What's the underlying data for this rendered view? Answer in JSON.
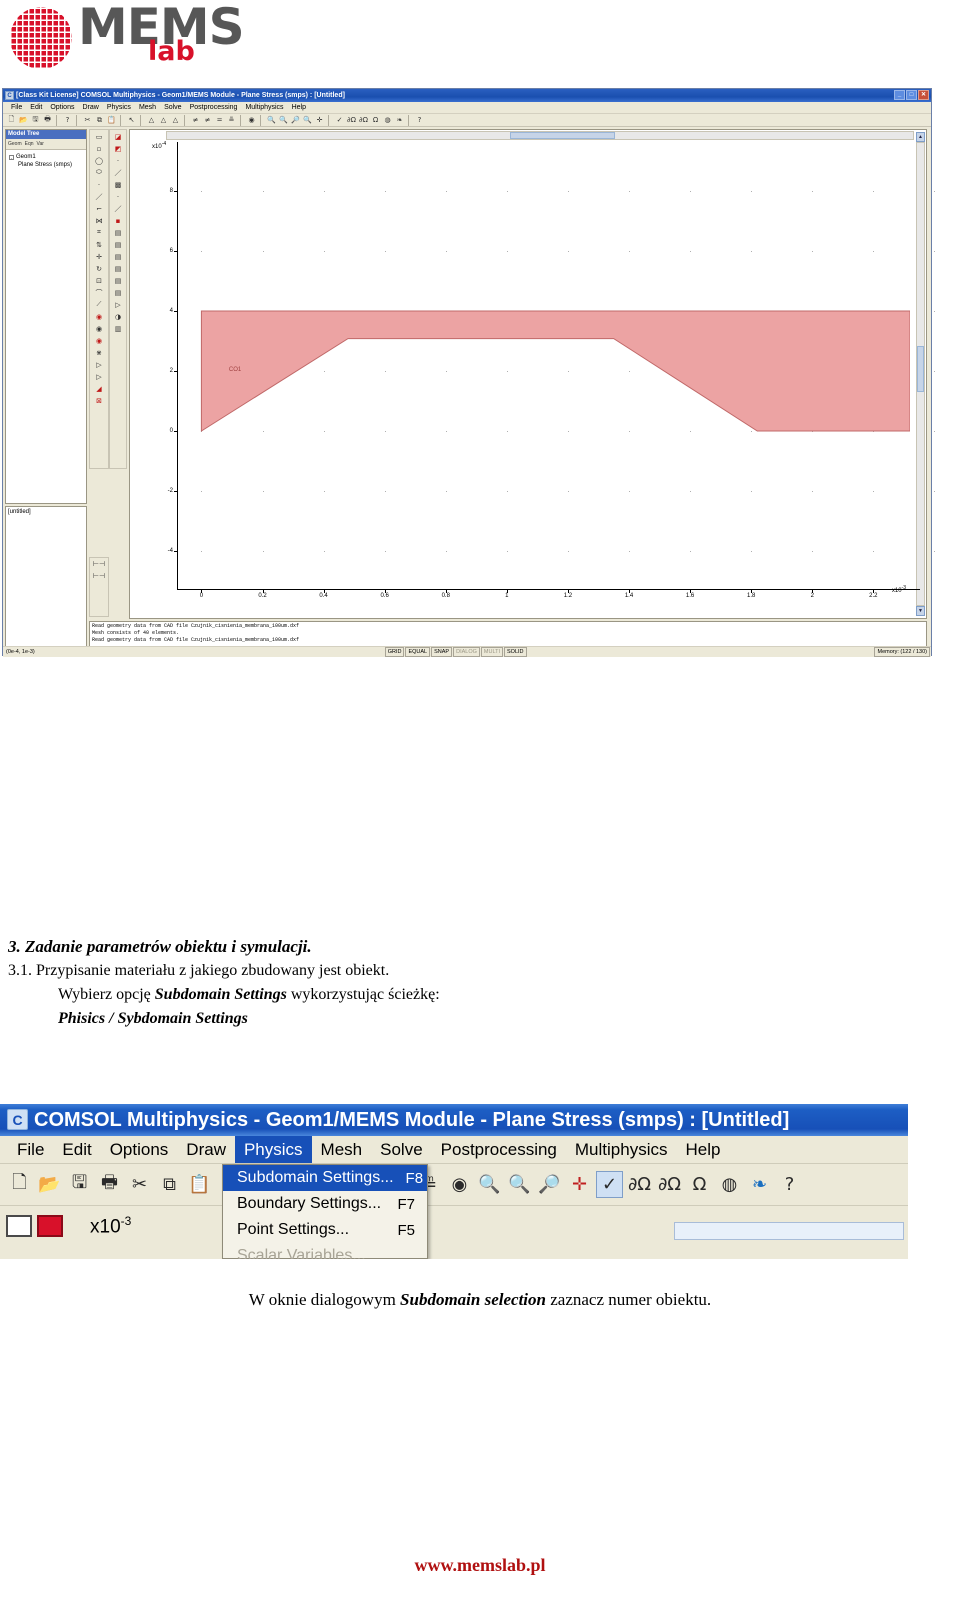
{
  "logo": {
    "brand": "MEMS",
    "sub": "lab",
    "wafer_color": "#d8112a"
  },
  "comsol_main": {
    "title": "[Class Kit License] COMSOL Multiphysics - Geom1/MEMS Module - Plane Stress (smps) : [Untitled]",
    "window_buttons": [
      "_",
      "□",
      "✕"
    ],
    "menus": [
      "File",
      "Edit",
      "Options",
      "Draw",
      "Physics",
      "Mesh",
      "Solve",
      "Postprocessing",
      "Multiphysics",
      "Help"
    ],
    "toolbar_icons": [
      "new-icon",
      "open-icon",
      "save-icon",
      "print-icon",
      "help-pointer-icon",
      "cut-icon",
      "copy-icon",
      "paste-icon",
      "select-arrow-icon",
      "triangle-mesh-icon",
      "triangle-refine-icon",
      "triangle-coarse-icon",
      "solve-icon",
      "restart-icon",
      "equals-icon",
      "plot-icon",
      "postprocess-icon",
      "zoom-in-icon",
      "zoom-out-icon",
      "zoom-window-icon",
      "zoom-extents-icon",
      "headlight-icon",
      "check-icon",
      "omega2-icon",
      "domega-icon",
      "omega-icon",
      "mesh-globe-icon",
      "colors-icon",
      "help-icon"
    ],
    "model_tree": {
      "title": "Model Tree",
      "tabs": [
        "Geom",
        "Eqn",
        "Var"
      ],
      "nodes": [
        {
          "label": "Geom1",
          "expand": "-"
        },
        {
          "label": "Plane Stress (smps)",
          "expand": ""
        }
      ]
    },
    "untitled_panel": "[untitled]",
    "plot": {
      "y_exponent": "x10",
      "y_exponent_sup": "-4",
      "x_exponent": "x10",
      "x_exponent_sup": "-3",
      "subdomain_label": "CO1"
    },
    "log_lines": [
      "Read geometry data from CAD file Czujnik_cisnienia_membrana_100um.dxf",
      "Mesh consists of 40 elements.",
      "Read geometry data from CAD file Czujnik_cisnienia_membrana_100um.dxf"
    ],
    "status": {
      "coords": "(0e-4, 1e-3)",
      "indicators": [
        {
          "label": "GRID",
          "on": true
        },
        {
          "label": "EQUAL",
          "on": true
        },
        {
          "label": "SNAP",
          "on": true
        },
        {
          "label": "DIALOG",
          "on": false
        },
        {
          "label": "MULTI",
          "on": false
        },
        {
          "label": "SOLID",
          "on": true
        }
      ],
      "memory": "Memory: (122 / 130)"
    }
  },
  "chart_data": {
    "type": "area",
    "title": "",
    "xlabel": "",
    "ylabel": "",
    "x_ticks": [
      0,
      0.2,
      0.4,
      0.6,
      0.8,
      1,
      1.2,
      1.4,
      1.6,
      1.8,
      2,
      2.2
    ],
    "x_tick_labels": [
      "0",
      "0.2",
      "0.4",
      "0.6",
      "0.8",
      "1",
      "1.2",
      "1.4",
      "1.6",
      "1.8",
      "2",
      "2.2"
    ],
    "y_ticks": [
      8,
      6,
      4,
      2,
      0,
      -2,
      -4
    ],
    "y_tick_labels": [
      "8",
      "6",
      "4",
      "2",
      "0",
      "-2",
      "-4"
    ],
    "xlim": [
      -0.08,
      2.32
    ],
    "ylim": [
      -5.3,
      9.3
    ],
    "x_scale": "x10^-3",
    "y_scale": "x10^-4",
    "grid": true,
    "series": [
      {
        "name": "CO1",
        "fill": "#eca3a3",
        "stroke": "#c06868",
        "polygon_x": [
          0.0,
          2.32,
          2.32,
          1.82,
          1.35,
          0.48,
          0.0
        ],
        "polygon_y": [
          4.0,
          4.0,
          0.0,
          0.0,
          3.08,
          3.08,
          0.0
        ]
      }
    ]
  },
  "instructions": {
    "heading": "3. Zadanie parametrów obiektu i symulacji.",
    "line1": "3.1. Przypisanie materiału z jakiego zbudowany jest obiekt.",
    "line2_a": "Wybierz opcję ",
    "line2_b": "Subdomain Settings",
    "line2_c": " wykorzystując ścieżkę:",
    "line3": "Phisics / Sybdomain Settings",
    "final_a": "W oknie dialogowym ",
    "final_b": "Subdomain selection",
    "final_c": " zaznacz numer obiektu."
  },
  "comsol_menu_shot": {
    "title": "COMSOL Multiphysics - Geom1/MEMS Module - Plane Stress (smps) : [Untitled]",
    "menus": [
      "File",
      "Edit",
      "Options",
      "Draw",
      "Physics",
      "Mesh",
      "Solve",
      "Postprocessing",
      "Multiphysics",
      "Help"
    ],
    "active_menu": "Physics",
    "dropdown_items": [
      {
        "label": "Subdomain Settings...",
        "key": "F8",
        "selected": true,
        "disabled": false
      },
      {
        "label": "Boundary Settings...",
        "key": "F7",
        "selected": false,
        "disabled": false
      },
      {
        "label": "Point Settings...",
        "key": "F5",
        "selected": false,
        "disabled": false
      },
      {
        "label": "Scalar Variables...",
        "key": "",
        "selected": false,
        "disabled": true
      }
    ],
    "toolbar_icons": [
      "new-icon",
      "open-icon",
      "save-icon",
      "print-icon",
      "cut-icon",
      "copy-icon",
      "paste-icon",
      "equals-icon",
      "plot-icon",
      "postprocess-icon",
      "zoom-in-icon",
      "zoom-out-icon",
      "zoom-window-icon",
      "zoom-extents-icon",
      "check-icon",
      "omega2-icon",
      "domega-icon",
      "omega-icon",
      "mesh-globe-icon",
      "colors-icon",
      "help-icon"
    ],
    "x10_label": "x10",
    "x10_sup": "-3"
  },
  "footer": "www.memslab.pl"
}
